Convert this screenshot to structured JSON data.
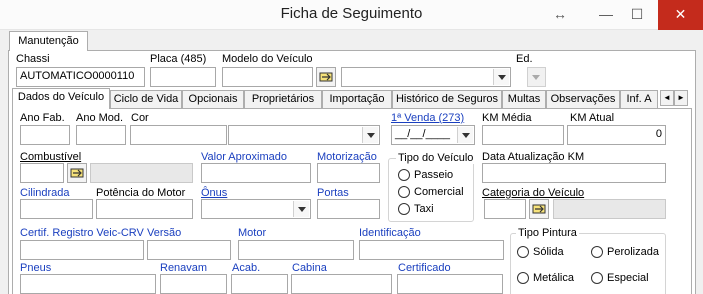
{
  "window": {
    "title": "Ficha de Seguimento",
    "resize_glyph": "↔",
    "minimize_glyph": "—",
    "maximize_glyph": "☐",
    "close_glyph": "✕"
  },
  "outer_tab": {
    "label": "Manutenção"
  },
  "header": {
    "chassi_label": "Chassi",
    "chassi_value": "AUTOMATICO0000110",
    "placa_label": "Placa (485)",
    "placa_value": "",
    "modelo_label": "Modelo do Veículo",
    "modelo_value": "",
    "ed_label": "Ed.",
    "ed_value": ""
  },
  "tabs": [
    {
      "label": "Dados do Veículo"
    },
    {
      "label": "Ciclo de Vida"
    },
    {
      "label": "Opcionais"
    },
    {
      "label": "Proprietários"
    },
    {
      "label": "Importação"
    },
    {
      "label": "Histórico de Seguros"
    },
    {
      "label": "Multas"
    },
    {
      "label": "Observações"
    },
    {
      "label": "Inf. A"
    }
  ],
  "tab_scroll": {
    "left": "◄",
    "right": "►"
  },
  "form": {
    "ano_fab_label": "Ano Fab.",
    "ano_mod_label": "Ano Mod.",
    "cor_label": "Cor",
    "primeira_venda_label": "1ª Venda (273)",
    "primeira_venda_value": "__/__/____",
    "km_media_label": "KM Média",
    "km_atual_label": "KM Atual",
    "km_atual_value": "0",
    "combustivel_label": "Combustível",
    "valor_aprox_label": "Valor Aproximado",
    "motorizacao_label": "Motorização",
    "tipo_veiculo_label": "Tipo do Veículo",
    "tipo_veiculo_options": [
      "Passeio",
      "Comercial",
      "Taxi"
    ],
    "data_atualizacao_label": "Data Atualização KM",
    "cilindrada_label": "Cilindrada",
    "potencia_label": "Potência do Motor",
    "onus_label": "Ônus",
    "portas_label": "Portas",
    "categoria_label": "Categoria do Veículo",
    "certif_label": "Certif. Registro Veic-CRV",
    "versao_label": "Versão",
    "motor_label": "Motor",
    "identificacao_label": "Identificação",
    "tipo_pintura_label": "Tipo Pintura",
    "pintura_options": [
      "Sólida",
      "Perolizada",
      "Metálica",
      "Especial"
    ],
    "pneus_label": "Pneus",
    "renavam_label": "Renavam",
    "acab_label": "Acab.",
    "cabina_label": "Cabina",
    "certificado_label": "Certificado"
  }
}
